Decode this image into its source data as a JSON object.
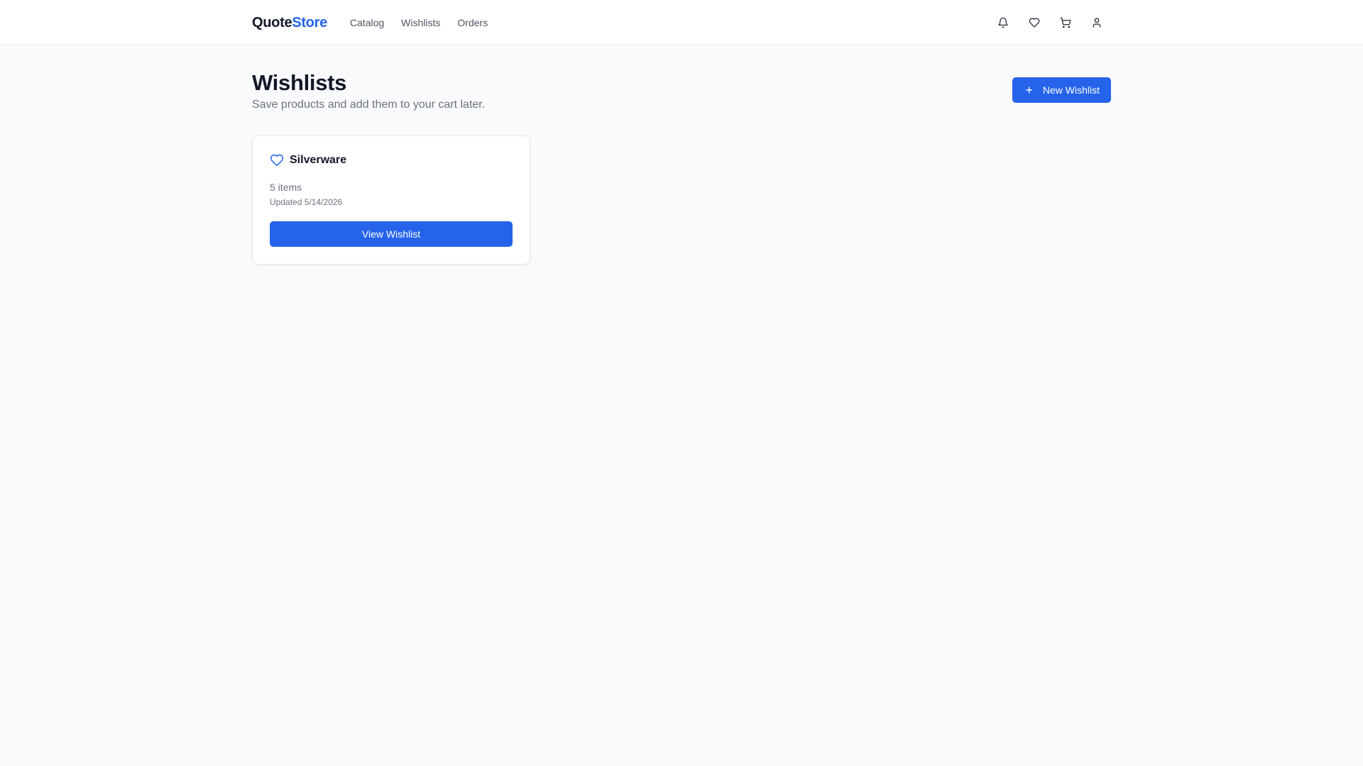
{
  "brand": {
    "part1": "Quote",
    "part2": "Store",
    "accent_color": "#2563eb"
  },
  "nav": {
    "items": [
      {
        "label": "Catalog"
      },
      {
        "label": "Wishlists"
      },
      {
        "label": "Orders"
      }
    ]
  },
  "header_icons": [
    "bell-icon",
    "heart-icon",
    "cart-icon",
    "user-icon"
  ],
  "page": {
    "title": "Wishlists",
    "subtitle": "Save products and add them to your cart later.",
    "new_button_label": "New Wishlist"
  },
  "wishlists": [
    {
      "name": "Silverware",
      "count_text": "5 items",
      "updated_text": "Updated 5/14/2026",
      "button_label": "View Wishlist"
    }
  ]
}
